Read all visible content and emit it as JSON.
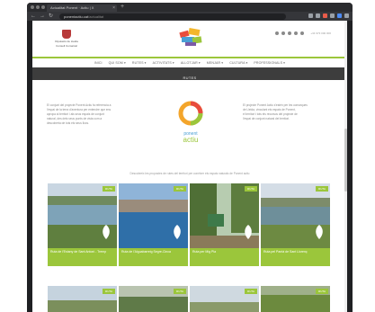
{
  "browser": {
    "tab_title": "Actualitat Ponent · Actiu | X",
    "tab_close": "×",
    "new_tab": "+",
    "nav_buttons": [
      "←",
      "→",
      "↻"
    ],
    "url_domain": "ponentactiu.cat",
    "url_path": "/actualitat"
  },
  "header": {
    "council_name": "Diputació de Lleida",
    "council_sub": "Consell Comarcal",
    "social_text": "+34 973 000 000"
  },
  "nav": {
    "items": [
      "INICI",
      "QUI SOM ▾",
      "RUTES ▾",
      "ACTIVITATS ▾",
      "ALLOTJAR ▾",
      "MENJAR ▾",
      "CULTURA ▾",
      "PROFESSIONALS ▾"
    ]
  },
  "page": {
    "title": "RUTES"
  },
  "intro": {
    "left_lines": [
      "El conjunt del projecte Ponent Actiu fa referència a",
      "l'espai de la terra d'aventura per entendre que ens",
      "apropa al territori i als seus espais de conjunt",
      "natural, des dels seus punts de vista com a",
      "descoberta de tots els seus llocs."
    ],
    "right_lines": [
      "El projecte Ponent Actiu s'estén per les comarques",
      "de Lleida, vinculant els espais de Ponent,",
      "el territori i tots els recursos del projecte de",
      "l'espai de conjunt natural del territori."
    ],
    "logo_top": "ponent",
    "logo_bottom": "actiu"
  },
  "section_intro": "Descobreix les propostes de rutes del territori per conèixer els espais naturals de Ponent actiu",
  "cards": [
    {
      "tag": "RUTA",
      "label": "Ruta de l'Estany de Sant Antoni - Tremp"
    },
    {
      "tag": "RUTA",
      "label": "Ruta de l'Aiguabarreig Segre-Cinca"
    },
    {
      "tag": "RUTA",
      "label": "Ruta per Mig Pla"
    },
    {
      "tag": "RUTA",
      "label": "Ruta pel Pantà de Sant Llorenç"
    }
  ],
  "cards_row2_tags": [
    "RUTA",
    "RUTA",
    "RUTA",
    "RUTA"
  ],
  "colors": {
    "accent_green": "#9bc63b",
    "band_dark": "#3d3d3d",
    "browser_dark": "#1f2023"
  }
}
